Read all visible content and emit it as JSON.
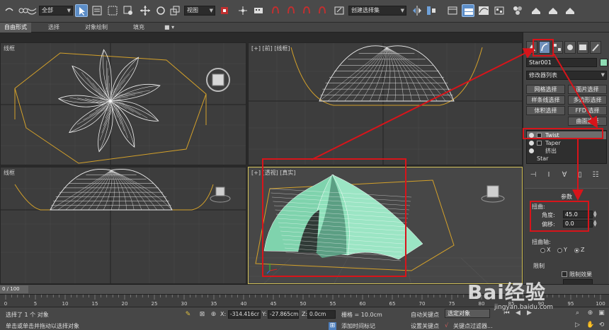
{
  "toolbar": {
    "selection_filter": "全部",
    "reference_coord": "视图",
    "named_selection": "创建选择集"
  },
  "ribbon": {
    "tabs": [
      "自由形式",
      "选择",
      "对象绘制",
      "填充"
    ]
  },
  "viewports": {
    "top": {
      "label": "线框"
    },
    "front": {
      "label": "[+] [前] [线框]"
    },
    "left": {
      "label": "线框"
    },
    "perspective": {
      "label": "[+] [透视] [真实]"
    }
  },
  "command_panel": {
    "object_name": "Star001",
    "object_color": "#8fdcb4",
    "modifier_list": "修改器列表",
    "buttons": [
      "网格选择",
      "面片选择",
      "样条线选择",
      "多边形选择",
      "体积选择",
      "FFD 选择",
      "曲面选择"
    ],
    "stack": [
      {
        "label": "Twist",
        "selected": true
      },
      {
        "label": "Taper",
        "selected": false
      },
      {
        "label": "挤出",
        "selected": false
      },
      {
        "label": "Star",
        "selected": false
      }
    ],
    "rollout_title": "参数",
    "twist_group": "扭曲:",
    "angle_label": "角度:",
    "angle_value": "45.0",
    "bias_label": "偏移:",
    "bias_value": "0.0",
    "axis_group": "扭曲轴:",
    "axes": [
      "X",
      "Y",
      "Z"
    ],
    "selected_axis": "Z",
    "limits_group": "限制",
    "limit_effect": "限制效果"
  },
  "timeline": {
    "frame_display": "0 / 100",
    "ticks": [
      "0",
      "5",
      "10",
      "15",
      "20",
      "25",
      "30",
      "35",
      "40",
      "45",
      "50",
      "55",
      "60",
      "65",
      "70",
      "75",
      "80",
      "85",
      "90",
      "95",
      "100"
    ]
  },
  "status": {
    "selected_text": "选择了 1 个 对象",
    "hint_text": "单击或单击并拖动以选择对象",
    "x_label": "X:",
    "x_value": "-314.416cr",
    "y_label": "Y:",
    "y_value": "-27.865cm",
    "z_label": "Z:",
    "z_value": "0.0cm",
    "grid_text": "栅格 = 10.0cm",
    "add_time_tag": "添加时间标记",
    "auto_key": "自动关键点",
    "set_key": "设置关键点",
    "selected_object": "选定对象",
    "key_filters": "关键点过滤器..."
  },
  "watermark": {
    "brand": "Bai经验",
    "url": "jingyan.baidu.com"
  },
  "colors": {
    "highlight": "#d8141a",
    "model": "#8fdcb4",
    "bounding": "#d4a12a"
  }
}
